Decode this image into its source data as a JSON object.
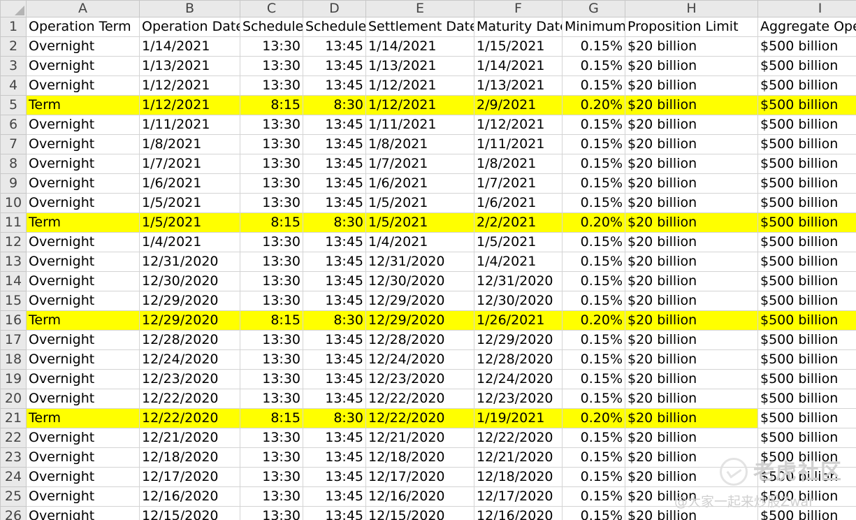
{
  "colors": {
    "highlight": "#ffff00",
    "header_bg": "#e9e9e9",
    "gridline": "#d4d4d4"
  },
  "column_letters": [
    "A",
    "B",
    "C",
    "D",
    "E",
    "F",
    "G",
    "H",
    "I"
  ],
  "headers": [
    "Operation Term",
    "Operation Date",
    "Scheduled",
    "Scheduled",
    "Settlement Date",
    "Maturity Date",
    "Minimum",
    "Proposition Limit",
    "Aggregate Opera"
  ],
  "rows": [
    {
      "n": "2",
      "term": "Overnight",
      "op_date": "1/14/2021",
      "start": "13:30",
      "end": "13:45",
      "settle": "1/14/2021",
      "maturity": "1/15/2021",
      "min": "0.15%",
      "limit": "$20 billion",
      "agg": "$500 billion",
      "hl": false
    },
    {
      "n": "3",
      "term": "Overnight",
      "op_date": "1/13/2021",
      "start": "13:30",
      "end": "13:45",
      "settle": "1/13/2021",
      "maturity": "1/14/2021",
      "min": "0.15%",
      "limit": "$20 billion",
      "agg": "$500 billion",
      "hl": false
    },
    {
      "n": "4",
      "term": "Overnight",
      "op_date": "1/12/2021",
      "start": "13:30",
      "end": "13:45",
      "settle": "1/12/2021",
      "maturity": "1/13/2021",
      "min": "0.15%",
      "limit": "$20 billion",
      "agg": "$500 billion",
      "hl": false
    },
    {
      "n": "5",
      "term": "Term",
      "op_date": "1/12/2021",
      "start": "8:15",
      "end": "8:30",
      "settle": "1/12/2021",
      "maturity": "2/9/2021",
      "min": "0.20%",
      "limit": "$20 billion",
      "agg": "$500 billion",
      "hl": true
    },
    {
      "n": "6",
      "term": "Overnight",
      "op_date": "1/11/2021",
      "start": "13:30",
      "end": "13:45",
      "settle": "1/11/2021",
      "maturity": "1/12/2021",
      "min": "0.15%",
      "limit": "$20 billion",
      "agg": "$500 billion",
      "hl": false
    },
    {
      "n": "7",
      "term": "Overnight",
      "op_date": "1/8/2021",
      "start": "13:30",
      "end": "13:45",
      "settle": "1/8/2021",
      "maturity": "1/11/2021",
      "min": "0.15%",
      "limit": "$20 billion",
      "agg": "$500 billion",
      "hl": false
    },
    {
      "n": "8",
      "term": "Overnight",
      "op_date": "1/7/2021",
      "start": "13:30",
      "end": "13:45",
      "settle": "1/7/2021",
      "maturity": "1/8/2021",
      "min": "0.15%",
      "limit": "$20 billion",
      "agg": "$500 billion",
      "hl": false
    },
    {
      "n": "9",
      "term": "Overnight",
      "op_date": "1/6/2021",
      "start": "13:30",
      "end": "13:45",
      "settle": "1/6/2021",
      "maturity": "1/7/2021",
      "min": "0.15%",
      "limit": "$20 billion",
      "agg": "$500 billion",
      "hl": false
    },
    {
      "n": "10",
      "term": "Overnight",
      "op_date": "1/5/2021",
      "start": "13:30",
      "end": "13:45",
      "settle": "1/5/2021",
      "maturity": "1/6/2021",
      "min": "0.15%",
      "limit": "$20 billion",
      "agg": "$500 billion",
      "hl": false
    },
    {
      "n": "11",
      "term": "Term",
      "op_date": "1/5/2021",
      "start": "8:15",
      "end": "8:30",
      "settle": "1/5/2021",
      "maturity": "2/2/2021",
      "min": "0.20%",
      "limit": "$20 billion",
      "agg": "$500 billion",
      "hl": true
    },
    {
      "n": "12",
      "term": "Overnight",
      "op_date": "1/4/2021",
      "start": "13:30",
      "end": "13:45",
      "settle": "1/4/2021",
      "maturity": "1/5/2021",
      "min": "0.15%",
      "limit": "$20 billion",
      "agg": "$500 billion",
      "hl": false
    },
    {
      "n": "13",
      "term": "Overnight",
      "op_date": "12/31/2020",
      "start": "13:30",
      "end": "13:45",
      "settle": "12/31/2020",
      "maturity": "1/4/2021",
      "min": "0.15%",
      "limit": "$20 billion",
      "agg": "$500 billion",
      "hl": false
    },
    {
      "n": "14",
      "term": "Overnight",
      "op_date": "12/30/2020",
      "start": "13:30",
      "end": "13:45",
      "settle": "12/30/2020",
      "maturity": "12/31/2020",
      "min": "0.15%",
      "limit": "$20 billion",
      "agg": "$500 billion",
      "hl": false
    },
    {
      "n": "15",
      "term": "Overnight",
      "op_date": "12/29/2020",
      "start": "13:30",
      "end": "13:45",
      "settle": "12/29/2020",
      "maturity": "12/30/2020",
      "min": "0.15%",
      "limit": "$20 billion",
      "agg": "$500 billion",
      "hl": false
    },
    {
      "n": "16",
      "term": "Term",
      "op_date": "12/29/2020",
      "start": "8:15",
      "end": "8:30",
      "settle": "12/29/2020",
      "maturity": "1/26/2021",
      "min": "0.20%",
      "limit": "$20 billion",
      "agg": "$500 billion",
      "hl": true
    },
    {
      "n": "17",
      "term": "Overnight",
      "op_date": "12/28/2020",
      "start": "13:30",
      "end": "13:45",
      "settle": "12/28/2020",
      "maturity": "12/29/2020",
      "min": "0.15%",
      "limit": "$20 billion",
      "agg": "$500 billion",
      "hl": false
    },
    {
      "n": "18",
      "term": "Overnight",
      "op_date": "12/24/2020",
      "start": "13:30",
      "end": "13:45",
      "settle": "12/24/2020",
      "maturity": "12/28/2020",
      "min": "0.15%",
      "limit": "$20 billion",
      "agg": "$500 billion",
      "hl": false
    },
    {
      "n": "19",
      "term": "Overnight",
      "op_date": "12/23/2020",
      "start": "13:30",
      "end": "13:45",
      "settle": "12/23/2020",
      "maturity": "12/24/2020",
      "min": "0.15%",
      "limit": "$20 billion",
      "agg": "$500 billion",
      "hl": false
    },
    {
      "n": "20",
      "term": "Overnight",
      "op_date": "12/22/2020",
      "start": "13:30",
      "end": "13:45",
      "settle": "12/22/2020",
      "maturity": "12/23/2020",
      "min": "0.15%",
      "limit": "$20 billion",
      "agg": "$500 billion",
      "hl": false
    },
    {
      "n": "21",
      "term": "Term",
      "op_date": "12/22/2020",
      "start": "8:15",
      "end": "8:30",
      "settle": "12/22/2020",
      "maturity": "1/19/2021",
      "min": "0.20%",
      "limit": "$20 billion",
      "agg": "$500 billion",
      "hl": true,
      "hl_partial": true
    },
    {
      "n": "22",
      "term": "Overnight",
      "op_date": "12/21/2020",
      "start": "13:30",
      "end": "13:45",
      "settle": "12/21/2020",
      "maturity": "12/22/2020",
      "min": "0.15%",
      "limit": "$20 billion",
      "agg": "$500 billion",
      "hl": false
    },
    {
      "n": "23",
      "term": "Overnight",
      "op_date": "12/18/2020",
      "start": "13:30",
      "end": "13:45",
      "settle": "12/18/2020",
      "maturity": "12/21/2020",
      "min": "0.15%",
      "limit": "$20 billion",
      "agg": "$500 billion",
      "hl": false
    },
    {
      "n": "24",
      "term": "Overnight",
      "op_date": "12/17/2020",
      "start": "13:30",
      "end": "13:45",
      "settle": "12/17/2020",
      "maturity": "12/18/2020",
      "min": "0.15%",
      "limit": "$20 billion",
      "agg": "$500 billion",
      "hl": false
    },
    {
      "n": "25",
      "term": "Overnight",
      "op_date": "12/16/2020",
      "start": "13:30",
      "end": "13:45",
      "settle": "12/16/2020",
      "maturity": "12/17/2020",
      "min": "0.15%",
      "limit": "$20 billion",
      "agg": "$500 billion",
      "hl": false
    },
    {
      "n": "26",
      "term": "Overnight",
      "op_date": "12/15/2020",
      "start": "13:30",
      "end": "13:45",
      "settle": "12/15/2020",
      "maturity": "12/16/2020",
      "min": "0.15%",
      "limit": "$20 billion",
      "agg": "$500 billion",
      "hl": false
    }
  ],
  "watermark": {
    "brand": "老虎社区",
    "handle": "@大家一起来炒股Zwar"
  }
}
